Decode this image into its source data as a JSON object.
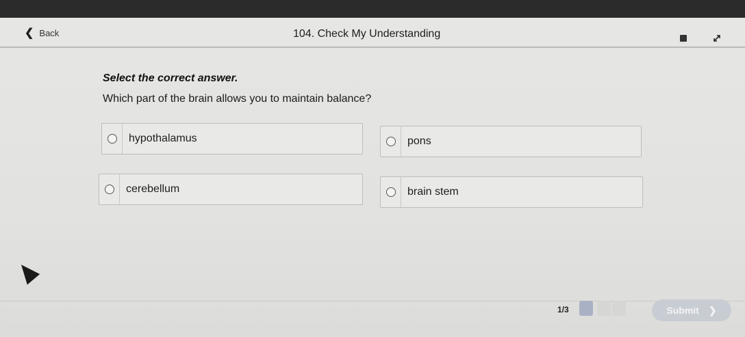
{
  "header": {
    "back_label": "Back",
    "title": "104. Check My Understanding"
  },
  "prompt": {
    "instruction": "Select the correct answer.",
    "question": "Which part of the brain allows you to maintain balance?"
  },
  "options": [
    {
      "label": "hypothalamus"
    },
    {
      "label": "pons"
    },
    {
      "label": "cerebellum"
    },
    {
      "label": "brain stem"
    }
  ],
  "footer": {
    "page_count": "1/3",
    "submit_label": "Submit"
  },
  "icons": {
    "back": "chevron-left-icon",
    "calculator": "calculator-icon",
    "expand": "expand-icon",
    "submit_arrow": "chevron-right-icon"
  }
}
